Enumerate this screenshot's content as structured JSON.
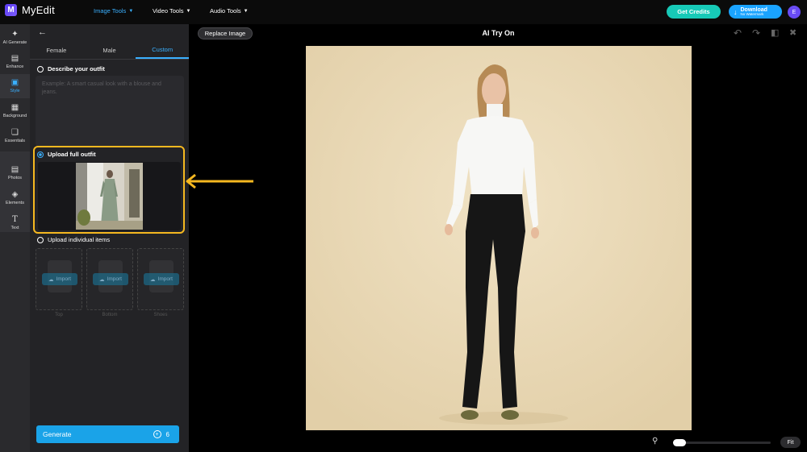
{
  "app": {
    "name": "MyEdit",
    "logo_letter": "M"
  },
  "nav": {
    "items": [
      {
        "label": "Image Tools",
        "active": true
      },
      {
        "label": "Video Tools",
        "active": false
      },
      {
        "label": "Audio Tools",
        "active": false
      }
    ]
  },
  "header": {
    "credits_label": "Get Credits",
    "download_label": "Download",
    "download_sub": "No Watermark",
    "avatar_initial": "E"
  },
  "rail": {
    "items": [
      {
        "label": "AI Generate",
        "icon": "magic-wand-icon"
      },
      {
        "label": "Enhance",
        "icon": "image-icon"
      },
      {
        "label": "Style",
        "icon": "portrait-icon",
        "active": true
      },
      {
        "label": "Background",
        "icon": "background-icon"
      },
      {
        "label": "Essentials",
        "icon": "crop-icon"
      },
      {
        "label": "Photos",
        "icon": "photo-icon"
      },
      {
        "label": "Elements",
        "icon": "elements-icon"
      },
      {
        "label": "Text",
        "icon": "text-icon"
      }
    ]
  },
  "panel": {
    "tabs": [
      {
        "label": "Female",
        "active": false
      },
      {
        "label": "Male",
        "active": false
      },
      {
        "label": "Custom",
        "active": true
      }
    ],
    "describe_label": "Describe your outfit",
    "describe_placeholder": "Example: A smart casual look with a blouse and jeans.",
    "upload_full_label": "Upload full outfit",
    "upload_items_label": "Upload individual items",
    "import_label": "Import",
    "item_labels": [
      "Top",
      "Bottom",
      "Shoes"
    ],
    "generate_label": "Generate",
    "generate_credits": "6"
  },
  "canvas": {
    "replace_label": "Replace Image",
    "title": "AI Try On",
    "fit_label": "Fit",
    "zoom_level": 0.0
  },
  "colors": {
    "accent": "#1aa3ff",
    "credits": "#17c9b7",
    "highlight": "#f5b820",
    "avatar": "#6a4cf5"
  }
}
